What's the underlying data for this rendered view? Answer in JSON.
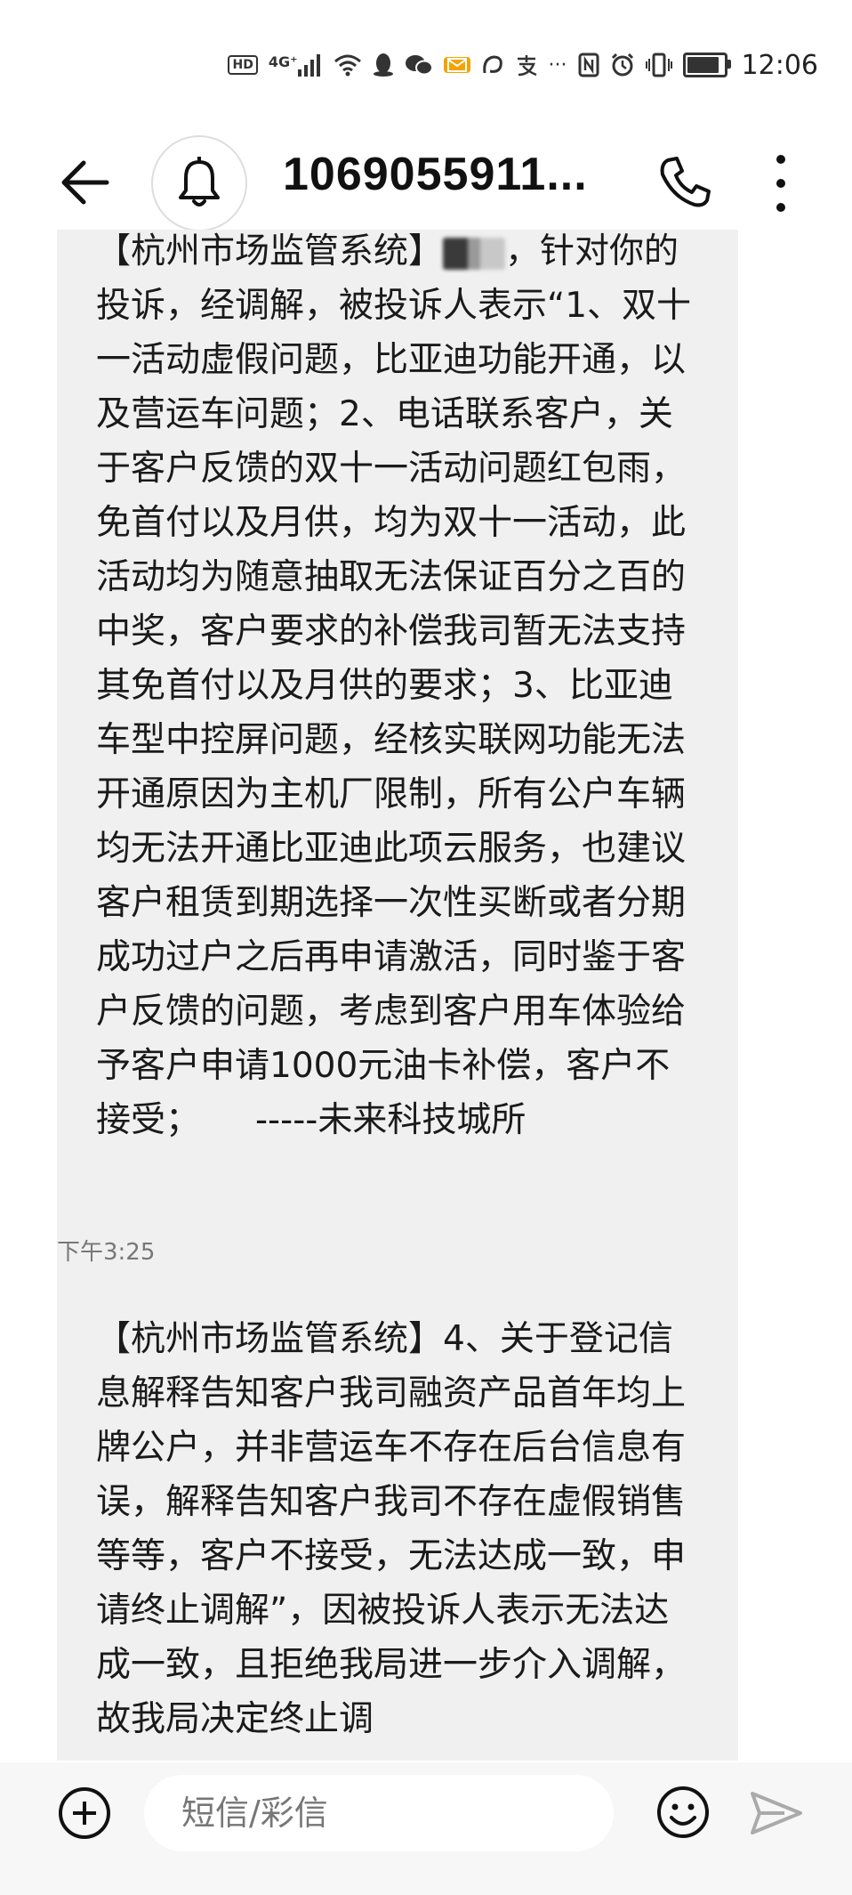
{
  "status_bar": {
    "hd_label": "HD",
    "network_label": "4G⁺",
    "battery_level": 0.85,
    "time": "12:06"
  },
  "header": {
    "contact": "1069055911...",
    "icons": {
      "back": "back-arrow-icon",
      "bell": "bell-icon",
      "call": "phone-icon",
      "more": "more-vertical-icon"
    }
  },
  "messages": [
    {
      "text_before": "【杭州市场监管系统】",
      "text_after": "，针对你的投诉，经调解，被投诉人表示“1、双十一活动虚假问题，比亚迪功能开通，以及营运车问题；2、电话联系客户，关于客户反馈的双十一活动问题红包雨，免首付以及月供，均为双十一活动，此活动均为随意抽取无法保证百分之百的中奖，客户要求的补偿我司暂无法支持其免首付以及月供的要求；3、比亚迪车型中控屏问题，经核实联网功能无法开通原因为主机厂限制，所有公户车辆均无法开通比亚迪此项云服务，也建议客户租赁到期选择一次性买断或者分期成功过户之后再申请激活，同时鉴于客户反馈的问题，考虑到客户用车体验给予客户申请1000元油卡补偿，客户不接受；     -----未来科技城所",
      "time": "下午3:25"
    },
    {
      "text": "【杭州市场监管系统】4、关于登记信息解释告知客户我司融资产品首年均上牌公户，并非营运车不存在后台信息有误，解释告知客户我司不存在虚假销售等等，客户不接受，无法达成一致，申请终止调解”，因被投诉人表示无法达成一致，且拒绝我局进一步介入调解，故我局决定终止调"
    }
  ],
  "compose": {
    "placeholder": "短信/彩信",
    "value": ""
  },
  "colors": {
    "bubble": "#f0f0f0",
    "compose_bg": "#f7f7f7",
    "mail_badge": "#f4a300"
  }
}
